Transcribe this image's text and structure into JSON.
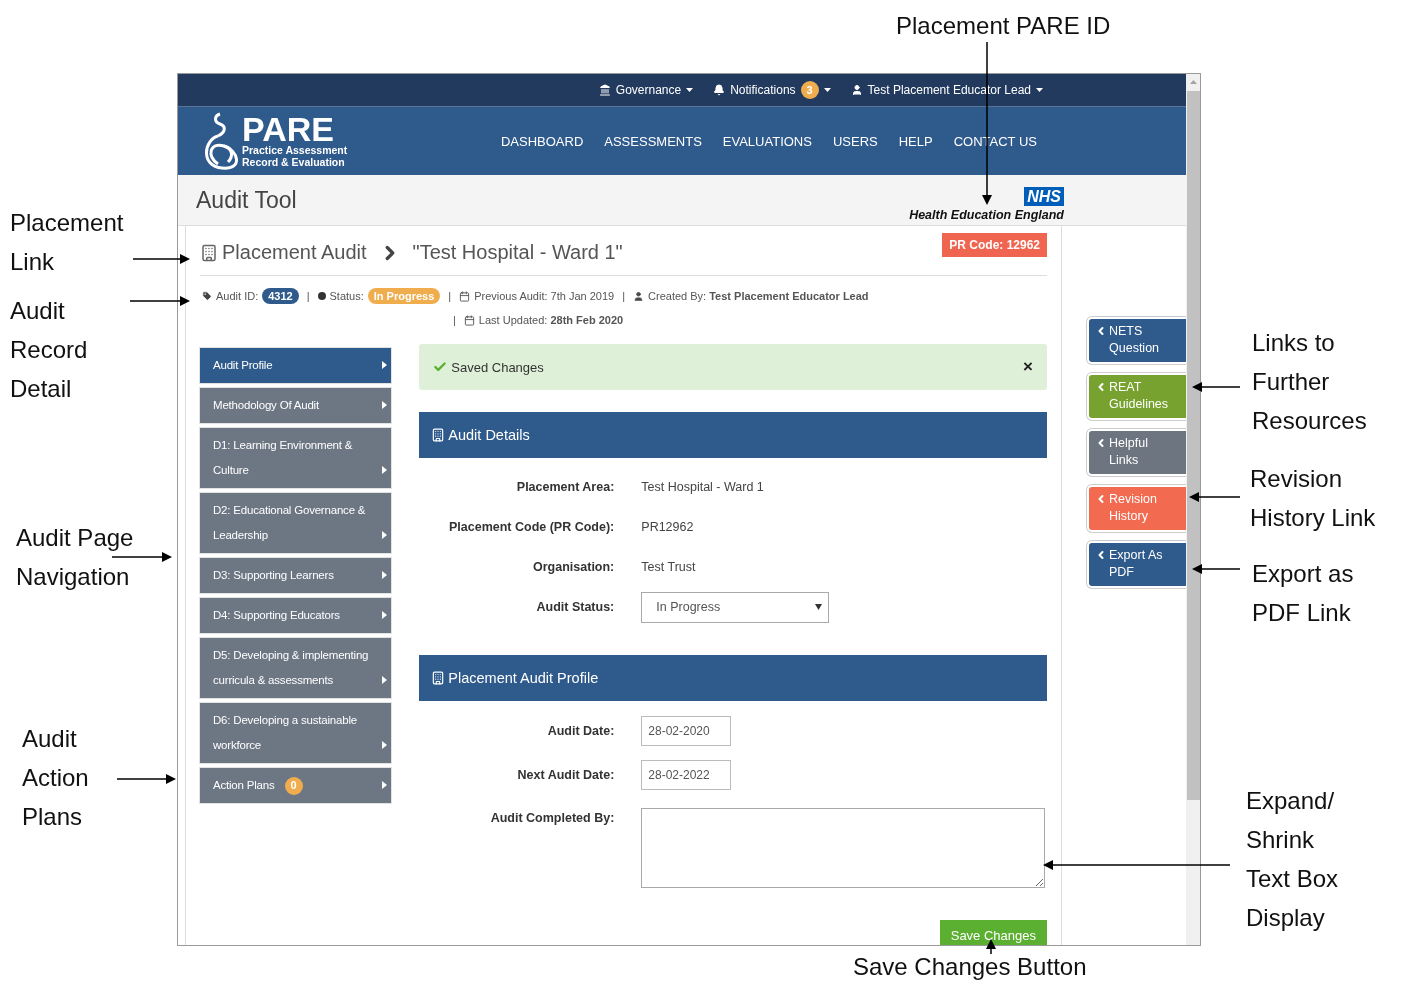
{
  "callouts": [
    {
      "lines": [
        "Placement PARE ID"
      ]
    },
    {
      "lines": [
        "Placement",
        "Link"
      ]
    },
    {
      "lines": [
        "Audit",
        "Record",
        "Detail"
      ]
    },
    {
      "lines": [
        "Audit Page",
        "Navigation"
      ]
    },
    {
      "lines": [
        "Audit",
        "Action",
        "Plans"
      ]
    },
    {
      "lines": [
        "Links to",
        "Further",
        "Resources"
      ]
    },
    {
      "lines": [
        "Revision",
        "History Link"
      ]
    },
    {
      "lines": [
        "Export as",
        "PDF Link"
      ]
    },
    {
      "lines": [
        "Expand/",
        "Shrink",
        "Text Box",
        "Display"
      ]
    },
    {
      "lines": [
        "Save Changes Button"
      ]
    }
  ],
  "top_bar": [
    {
      "label": "Governance"
    },
    {
      "label": "Notifications",
      "badge": "3"
    },
    {
      "label": "Test Placement Educator Lead"
    }
  ],
  "brand": {
    "name": "PARE",
    "tagline": [
      "Practice Assessment",
      "Record & Evaluation"
    ]
  },
  "nav": [
    "DASHBOARD",
    "ASSESSMENTS",
    "EVALUATIONS",
    "USERS",
    "HELP",
    "CONTACT US"
  ],
  "page_title": "Audit Tool",
  "nhs_logo": "NHS",
  "organisation_name": "Health Education England",
  "breadcrumb": {
    "section": "Placement Audit",
    "current": "\"Test Hospital - Ward 1\""
  },
  "pr_code": "PR Code: 12962",
  "meta_rows": [
    [
      {
        "kind": "tag",
        "label": "Audit ID:",
        "badge": "4312"
      },
      {
        "kind": "separator",
        "text": "|"
      },
      {
        "kind": "status",
        "label": "Status:",
        "badge": "In Progress"
      },
      {
        "kind": "separator",
        "text": "|"
      },
      {
        "kind": "calendar",
        "text": "Previous Audit: 7th Jan 2019"
      },
      {
        "kind": "separator",
        "text": "|"
      },
      {
        "kind": "user",
        "text": "Created By: **Test Placement Educator Lead**"
      }
    ],
    [
      {
        "kind": "separator",
        "text": "|"
      },
      {
        "kind": "calendar",
        "text": "Last Updated: **28th Feb 2020**"
      }
    ]
  ],
  "sidebar": [
    {
      "label": "Audit Profile",
      "selected": true
    },
    {
      "label": "Methodology Of Audit",
      "selected": false
    },
    {
      "label": "D1: Learning Environment & Culture",
      "selected": false
    },
    {
      "label": "D2: Educational Governance & Leadership",
      "selected": false
    },
    {
      "label": "D3: Supporting Learners",
      "selected": false
    },
    {
      "label": "D4: Supporting Educators",
      "selected": false
    },
    {
      "label": "D5: Developing & implementing curricula & assessments",
      "selected": false
    },
    {
      "label": "D6: Developing a sustainable workforce",
      "selected": false
    },
    {
      "label": "Action Plans",
      "badge": "0",
      "selected": false
    }
  ],
  "alert": {
    "text": "Saved Changes",
    "close": "×"
  },
  "sections": [
    {
      "title": "Audit Details",
      "fields": [
        {
          "kind": "text",
          "label": "Placement Area:",
          "value": "Test Hospital - Ward 1"
        },
        {
          "kind": "text",
          "label": "Placement Code (PR Code):",
          "value": "PR12962"
        },
        {
          "kind": "text",
          "label": "Organisation:",
          "value": "Test Trust"
        },
        {
          "kind": "select",
          "label": "Audit Status:",
          "value": "In Progress"
        }
      ]
    },
    {
      "title": "Placement Audit Profile",
      "fields": [
        {
          "kind": "date",
          "label": "Audit Date:",
          "value": "28-02-2020"
        },
        {
          "kind": "date",
          "label": "Next Audit Date:",
          "value": "28-02-2022"
        },
        {
          "kind": "textarea",
          "label": "Audit Completed By:"
        }
      ]
    }
  ],
  "save_button": "Save Changes",
  "side_tabs": [
    {
      "label": "NETS Question",
      "color": "#2f5a8c"
    },
    {
      "label": "REAT Guidelines",
      "color": "#77a22f"
    },
    {
      "label": "Helpful Links",
      "color": "#6d7580"
    },
    {
      "label": "Revision History",
      "color": "#f26a50"
    },
    {
      "label": "Export As PDF",
      "color": "#2f5a8c"
    }
  ]
}
